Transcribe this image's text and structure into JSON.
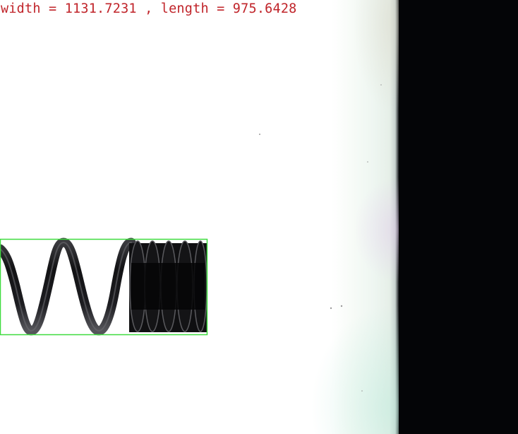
{
  "measurement": {
    "text": "width = 1131.7231 , length = 975.6428"
  },
  "colors": {
    "label_text": "#c0242a",
    "bounding_box": "#3fdc3f",
    "spring_metal": "#1c1c1e",
    "background_field": "#ffffff",
    "background_dark": "#040507"
  },
  "objects": {
    "spring_name": "coil-spring",
    "box_name": "detection-bounding-box"
  }
}
